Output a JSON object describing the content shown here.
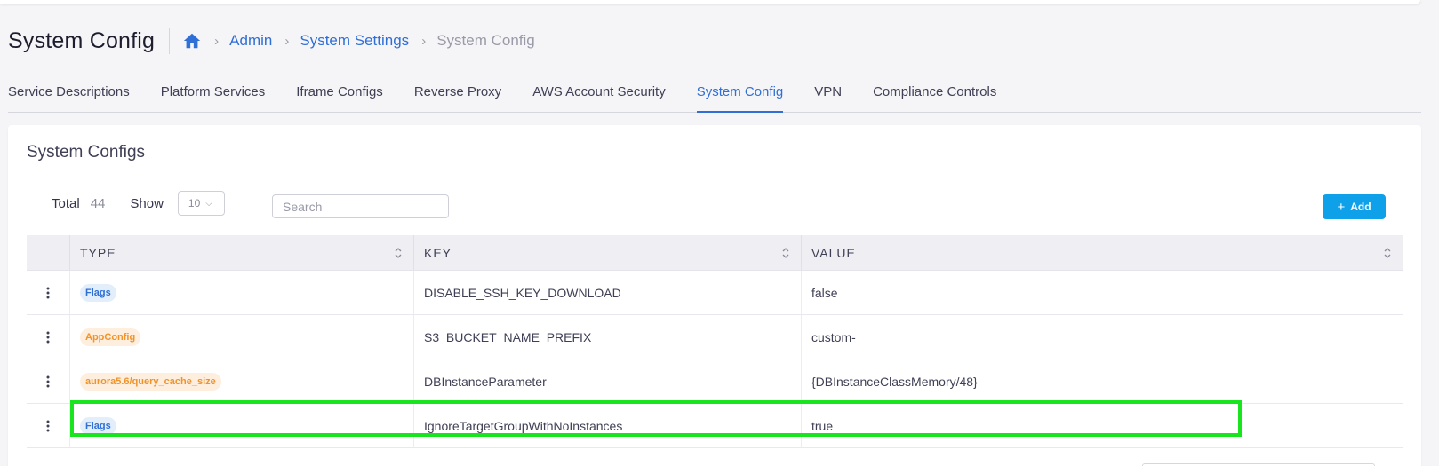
{
  "header": {
    "title": "System Config",
    "breadcrumbs": [
      {
        "label": "Admin",
        "link": true
      },
      {
        "label": "System Settings",
        "link": true
      },
      {
        "label": "System Config",
        "link": false
      }
    ]
  },
  "tabs": [
    {
      "label": "Service Descriptions",
      "active": false
    },
    {
      "label": "Platform Services",
      "active": false
    },
    {
      "label": "Iframe Configs",
      "active": false
    },
    {
      "label": "Reverse Proxy",
      "active": false
    },
    {
      "label": "AWS Account Security",
      "active": false
    },
    {
      "label": "System Config",
      "active": true
    },
    {
      "label": "VPN",
      "active": false
    },
    {
      "label": "Compliance Controls",
      "active": false
    }
  ],
  "card": {
    "title": "System Configs",
    "total_label": "Total",
    "total_value": "44",
    "show_label": "Show",
    "show_value": "10",
    "search_placeholder": "Search",
    "add_label": "Add"
  },
  "table": {
    "columns": [
      "TYPE",
      "KEY",
      "VALUE"
    ],
    "rows": [
      {
        "type": "Flags",
        "type_color": "blue",
        "key": "DISABLE_SSH_KEY_DOWNLOAD",
        "value": "false"
      },
      {
        "type": "AppConfig",
        "type_color": "orange",
        "key": "S3_BUCKET_NAME_PREFIX",
        "value": "custom-"
      },
      {
        "type": "aurora5.6/query_cache_size",
        "type_color": "orange",
        "key": "DBInstanceParameter",
        "value": "{DBInstanceClassMemory/48}"
      },
      {
        "type": "Flags",
        "type_color": "blue",
        "key": "IgnoreTargetGroupWithNoInstances",
        "value": "true"
      }
    ]
  },
  "colors": {
    "accent": "#2f6fd6",
    "add_button": "#0ea0e8",
    "highlight": "#18e51e"
  }
}
